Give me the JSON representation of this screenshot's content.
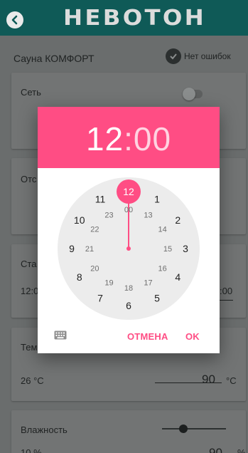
{
  "app": {
    "title": "НЕВОТОН"
  },
  "header": {
    "device_name": "Сауна КОМФОРТ",
    "status_text": "Нет ошибок"
  },
  "cards": {
    "network": {
      "label": "Сеть"
    },
    "card2": {
      "label_partial": "Отс"
    },
    "card3": {
      "label_partial": "Ста",
      "left_value_partial": "12:0",
      "right_value_partial": ":00"
    },
    "temperature": {
      "label_partial": "Тем",
      "current": "26 °C",
      "target": "90",
      "unit": "°C"
    },
    "humidity": {
      "label": "Влажность",
      "current_partial": "10 %",
      "target_partial": "90",
      "unit": "%",
      "slider_level": 0.33
    }
  },
  "time_picker": {
    "hour": "12",
    "separator": ":",
    "minute": "00",
    "selected_hour": "12",
    "outer_hours": [
      "12",
      "1",
      "2",
      "3",
      "4",
      "5",
      "6",
      "7",
      "8",
      "9",
      "10",
      "11"
    ],
    "inner_hours": [
      "00",
      "13",
      "14",
      "15",
      "16",
      "17",
      "18",
      "19",
      "20",
      "21",
      "22",
      "23"
    ],
    "cancel_label": "ОТМЕНА",
    "ok_label": "OK",
    "accent_color": "#ff4d84",
    "keyboard_icon": "keyboard-icon"
  },
  "colors": {
    "appbar": "#0f5a57",
    "accent": "#ff4d84"
  }
}
